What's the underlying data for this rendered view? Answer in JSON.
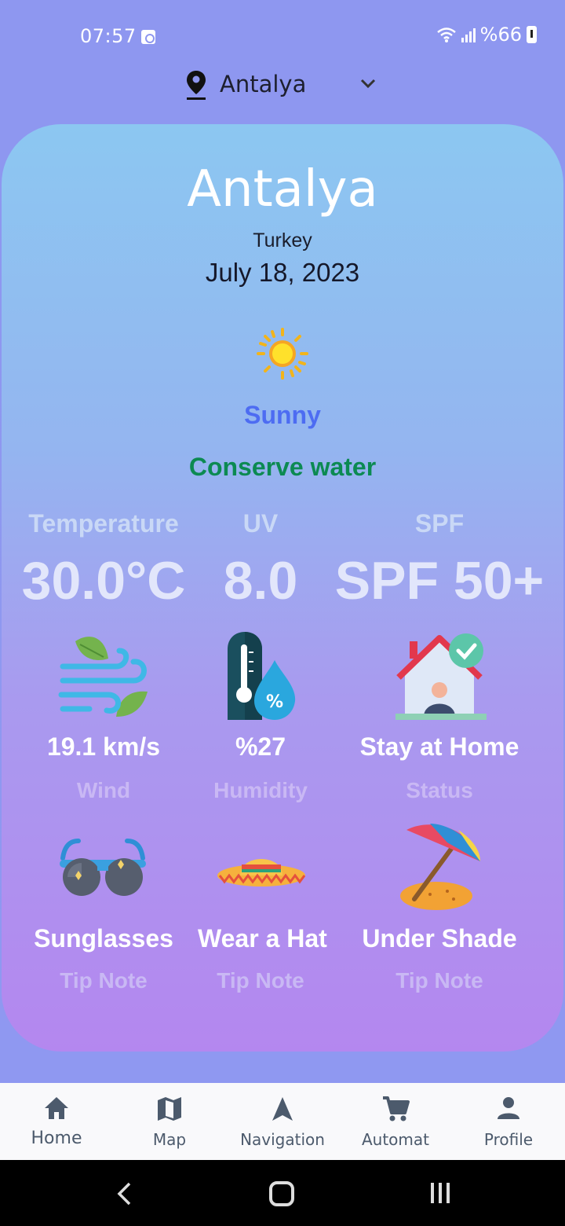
{
  "status_bar": {
    "time": "07:57",
    "battery": "%66"
  },
  "location_selector": {
    "city": "Antalya"
  },
  "weather": {
    "city": "Antalya",
    "country": "Turkey",
    "date": "July 18, 2023",
    "condition": "Sunny",
    "advice": "Conserve water"
  },
  "stats": [
    {
      "label": "Temperature",
      "value": "30.0°C"
    },
    {
      "label": "UV",
      "value": "8.0"
    },
    {
      "label": "SPF",
      "value": "SPF 50+"
    }
  ],
  "details": [
    {
      "value": "19.1 km/s",
      "label": "Wind",
      "icon": "wind-icon"
    },
    {
      "value": "%27",
      "label": "Humidity",
      "icon": "humidity-icon"
    },
    {
      "value": "Stay at Home",
      "label": "Status",
      "icon": "home-status-icon"
    }
  ],
  "tips": [
    {
      "value": "Sunglasses",
      "label": "Tip Note",
      "icon": "sunglasses-icon"
    },
    {
      "value": "Wear a Hat",
      "label": "Tip Note",
      "icon": "hat-icon"
    },
    {
      "value": "Under Shade",
      "label": "Tip Note",
      "icon": "beach-umbrella-icon"
    }
  ],
  "nav": [
    {
      "label": "Home",
      "icon": "home-icon",
      "active": true
    },
    {
      "label": "Map",
      "icon": "map-icon"
    },
    {
      "label": "Navigation",
      "icon": "navigation-icon"
    },
    {
      "label": "Automat",
      "icon": "cart-icon"
    },
    {
      "label": "Profile",
      "icon": "profile-icon"
    }
  ],
  "colors": {
    "condition": "#4d6cf2",
    "advice": "#0c8a52",
    "nav_text": "#4c5a6c"
  }
}
